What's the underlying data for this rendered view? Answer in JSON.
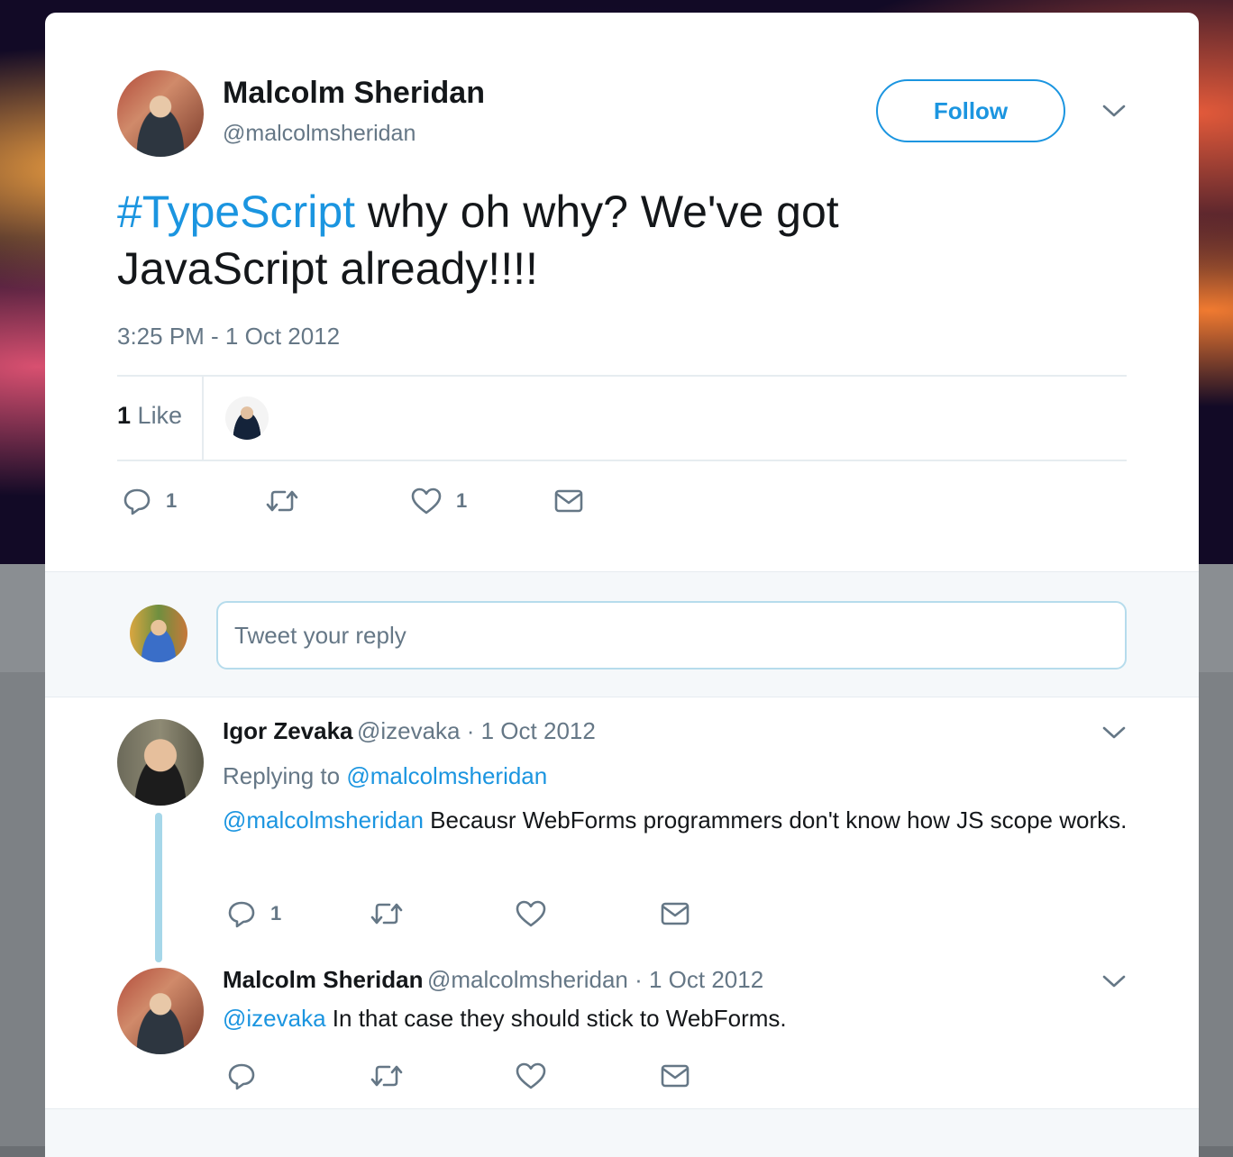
{
  "tweet": {
    "author_name": "Malcolm Sheridan",
    "author_handle": "@malcolmsheridan",
    "follow_label": "Follow",
    "hashtag": "#TypeScript",
    "text_rest": " why oh why? We've got JavaScript already!!!!",
    "timestamp": "3:25 PM - 1 Oct 2012",
    "likes_count": "1",
    "likes_label": "Like",
    "reply_count": "1",
    "like_count": "1"
  },
  "reply_box": {
    "placeholder": "Tweet your reply"
  },
  "replies": [
    {
      "name": "Igor Zevaka",
      "handle_date": "@izevaka · 1 Oct 2012",
      "replying_label": "Replying to ",
      "replying_to": "@malcolmsheridan",
      "mention": "@malcolmsheridan",
      "text": " Becausr WebForms programmers don't know how JS scope works.",
      "reply_count": "1"
    },
    {
      "name": "Malcolm Sheridan",
      "handle_date": "@malcolmsheridan · 1 Oct 2012",
      "mention": "@izevaka",
      "text": " In that case they should stick to WebForms."
    }
  ],
  "icons": [
    "reply-icon",
    "retweet-icon",
    "like-icon",
    "message-icon",
    "chevron-down-icon"
  ],
  "colors": {
    "link": "#1b95e0",
    "secondary": "#657786",
    "thread_line": "#a6d7e9"
  }
}
